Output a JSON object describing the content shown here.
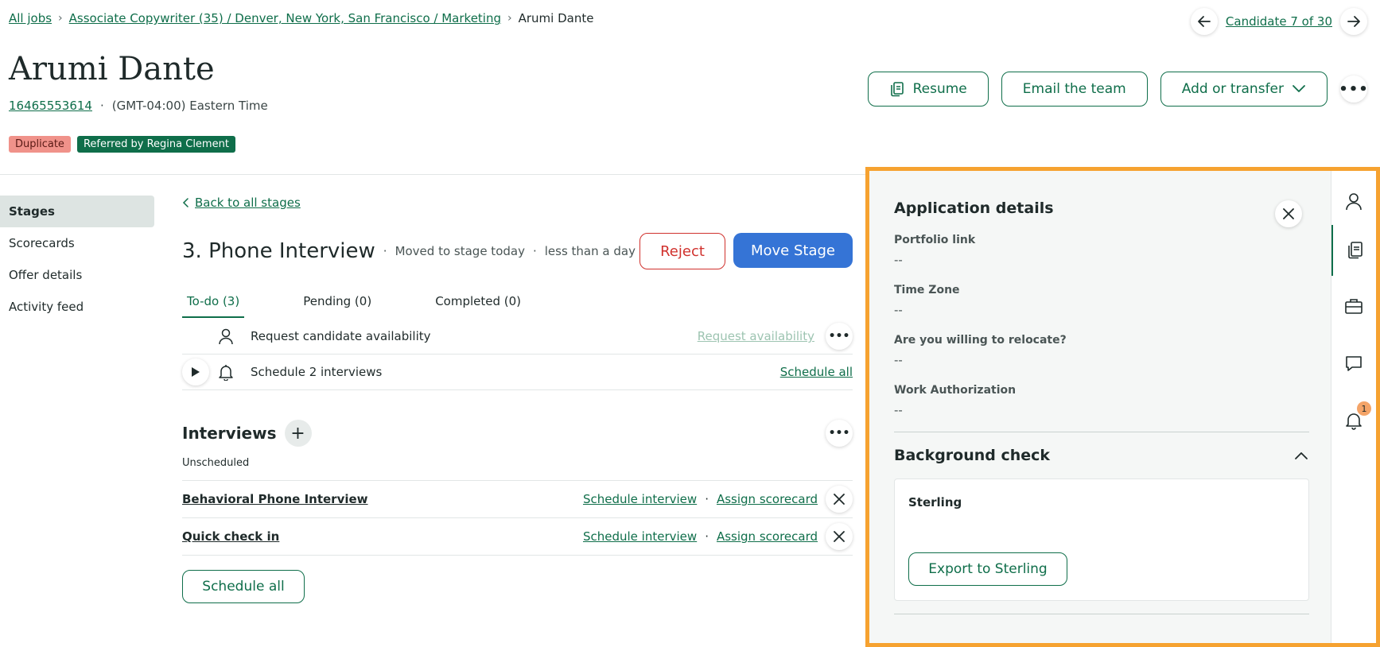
{
  "breadcrumb": {
    "all_jobs": "All jobs",
    "job": "Associate Copywriter (35) / Denver, New York, San Francisco / Marketing",
    "current": "Arumi Dante"
  },
  "candidate_nav": {
    "label": "Candidate 7 of 30"
  },
  "candidate": {
    "name": "Arumi Dante",
    "phone": "16465553614",
    "timezone": "(GMT-04:00) Eastern Time",
    "tags": {
      "duplicate": "Duplicate",
      "referred": "Referred by Regina Clement"
    }
  },
  "header_actions": {
    "resume": "Resume",
    "email_team": "Email the team",
    "add_transfer": "Add or transfer"
  },
  "left_nav": {
    "items": [
      "Stages",
      "Scorecards",
      "Offer details",
      "Activity feed"
    ]
  },
  "stage": {
    "back_link": "Back to all stages",
    "title": "3. Phone Interview",
    "moved": "Moved to stage today",
    "duration": "less than a day",
    "reject": "Reject",
    "move": "Move Stage",
    "tabs": [
      "To-do (3)",
      "Pending (0)",
      "Completed (0)"
    ],
    "todos": [
      {
        "text": "Request candidate availability",
        "action": "Request availability"
      },
      {
        "text": "Schedule 2 interviews",
        "action": "Schedule all"
      }
    ]
  },
  "interviews": {
    "title": "Interviews",
    "unscheduled_label": "Unscheduled",
    "items": [
      {
        "name": "Behavioral Phone Interview",
        "schedule": "Schedule interview",
        "assign": "Assign scorecard"
      },
      {
        "name": "Quick check in",
        "schedule": "Schedule interview",
        "assign": "Assign scorecard"
      }
    ],
    "schedule_all": "Schedule all"
  },
  "panel": {
    "title": "Application details",
    "fields": [
      {
        "label": "Portfolio link",
        "value": "--"
      },
      {
        "label": "Time Zone",
        "value": "--"
      },
      {
        "label": "Are you willing to relocate?",
        "value": "--"
      },
      {
        "label": "Work Authorization",
        "value": "--"
      }
    ],
    "background_check": {
      "title": "Background check",
      "vendor": "Sterling",
      "export": "Export to Sterling"
    },
    "rail": {
      "notification_count": "1"
    }
  },
  "colors": {
    "brand_green": "#0f6e4a",
    "reject_red": "#d0312d",
    "primary_blue": "#3574d6",
    "highlight_orange": "#f6a230",
    "tag_duplicate": "#f0928a"
  }
}
